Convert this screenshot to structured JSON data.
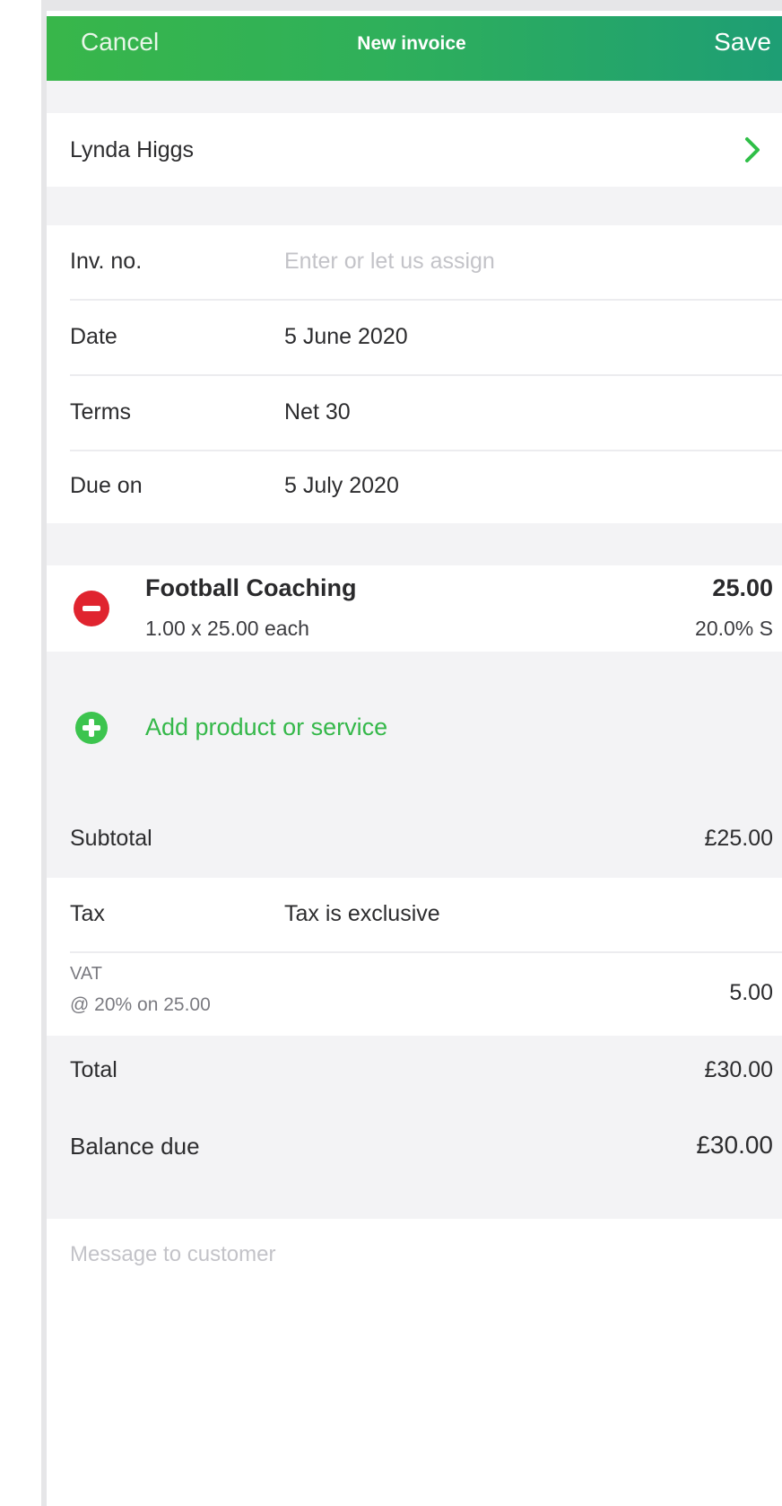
{
  "header": {
    "cancel_label": "Cancel",
    "title": "New invoice",
    "save_label": "Save"
  },
  "customer": {
    "name": "Lynda Higgs"
  },
  "details": {
    "inv_no_label": "Inv. no.",
    "inv_no_placeholder": "Enter or let us assign",
    "date_label": "Date",
    "date_value": "5 June 2020",
    "terms_label": "Terms",
    "terms_value": "Net 30",
    "due_label": "Due on",
    "due_value": "5 July 2020"
  },
  "line_items": [
    {
      "name": "Football Coaching",
      "qty_line": "1.00 x 25.00 each",
      "amount": "25.00",
      "tax_code": "20.0% S"
    }
  ],
  "add_item_label": "Add product or service",
  "totals": {
    "subtotal_label": "Subtotal",
    "subtotal_value": "£25.00",
    "tax_label": "Tax",
    "tax_value": "Tax is exclusive",
    "vat_label": "VAT",
    "vat_detail": "@ 20% on 25.00",
    "vat_value": "5.00",
    "total_label": "Total",
    "total_value": "£30.00",
    "balance_label": "Balance due",
    "balance_value": "£30.00"
  },
  "message_placeholder": "Message to customer",
  "colors": {
    "header_green": "#38b64a",
    "remove_red": "#e0242f",
    "add_green": "#3cc44e"
  }
}
